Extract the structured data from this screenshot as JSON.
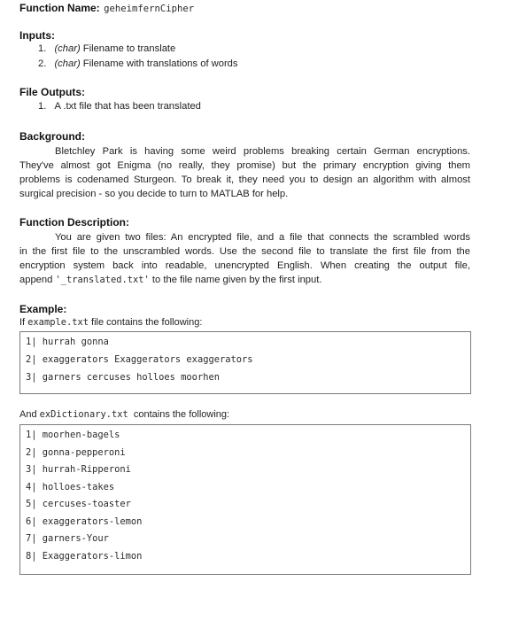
{
  "function_name": {
    "label": "Function Name:",
    "value": "geheimfernCipher"
  },
  "inputs": {
    "heading": "Inputs:",
    "items": [
      {
        "num": "1.",
        "type": "(char)",
        "text": " Filename to translate"
      },
      {
        "num": "2.",
        "type": "(char)",
        "text": " Filename with translations of words"
      }
    ]
  },
  "file_outputs": {
    "heading": "File Outputs:",
    "items": [
      {
        "num": "1.",
        "text": "A .txt file that has been translated"
      }
    ]
  },
  "background": {
    "heading": "Background:",
    "lines": [
      "Bletchley Park is having some weird problems breaking certain German encryptions.",
      "They've almost got Enigma (no really, they promise) but the primary encryption giving them",
      "problems is codenamed Sturgeon. To break it, they need you to design an algorithm with almost",
      "surgical precision - so you decide to turn to MATLAB for help."
    ]
  },
  "function_description": {
    "heading": "Function Description:",
    "lines": [
      "You are given two files: An encrypted file, and a file that connects the scrambled words",
      "in the first file to the unscrambled words. Use the second file to translate the first file from the",
      "encryption system back into readable, unencrypted English. When creating the output file,"
    ],
    "last_line_prefix": "append ",
    "last_line_code": "'_translated.txt'",
    "last_line_suffix": " to the file name given by the first input."
  },
  "example": {
    "heading": "Example:",
    "intro_prefix": "If ",
    "intro_code": "example.txt",
    "intro_suffix": " file contains the following:",
    "file_lines": [
      {
        "num": "1|",
        "text": "hurrah gonna"
      },
      {
        "num": "2|",
        "text": "exaggerators Exaggerators exaggerators"
      },
      {
        "num": "3|",
        "text": "garners cercuses holloes moorhen"
      }
    ],
    "dict_intro_prefix": "And ",
    "dict_intro_code": "exDictionary.txt",
    "dict_intro_suffix": "  contains the following:",
    "dict_lines": [
      {
        "num": "1|",
        "text": "moorhen-bagels"
      },
      {
        "num": "2|",
        "text": "gonna-pepperoni"
      },
      {
        "num": "3|",
        "text": "hurrah-Ripperoni"
      },
      {
        "num": "4|",
        "text": "holloes-takes"
      },
      {
        "num": "5|",
        "text": "cercuses-toaster"
      },
      {
        "num": "6|",
        "text": "exaggerators-lemon"
      },
      {
        "num": "7|",
        "text": "garners-Your"
      },
      {
        "num": "8|",
        "text": "Exaggerators-limon"
      }
    ]
  }
}
